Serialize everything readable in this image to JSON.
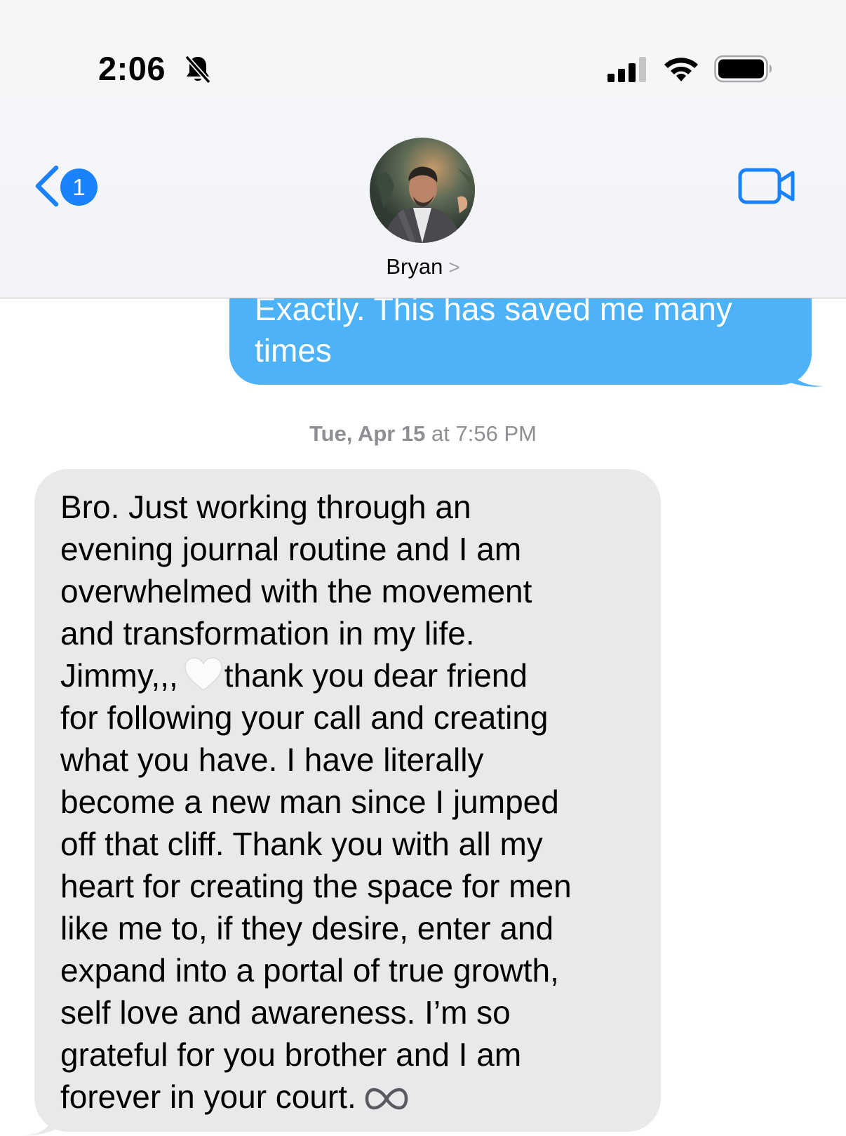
{
  "status_bar": {
    "time": "2:06",
    "icons": [
      "bell-slash-icon",
      "cellular-signal-icon",
      "wifi-icon",
      "battery-icon"
    ]
  },
  "header": {
    "back_badge_count": "1",
    "contact_name": "Bryan",
    "contact_chevron": ">",
    "video_icon": "video-camera-icon"
  },
  "messages": {
    "outgoing": {
      "lines": [
        "Exactly. This has saved me many",
        "times"
      ]
    },
    "timestamp": {
      "day": "Tue, Apr 15",
      "rest": " at 7:56 PM"
    },
    "incoming": {
      "line_1": "Bro. Just working through an",
      "line_2": "evening journal routine and I am",
      "line_3": "overwhelmed with the movement",
      "line_4": "and transformation in my life.",
      "line_5_a": "Jimmy,,,",
      "line_5_b": "thank you dear friend",
      "line_6": "for following your call and creating",
      "line_7": "what you have. I have literally",
      "line_8": "become a new man since I jumped",
      "line_9": "off that cliff. Thank you with all my",
      "line_10": "heart for creating the space for men",
      "line_11": "like me to, if they desire, enter and",
      "line_12": "expand into a portal of true growth,",
      "line_13": "self love and awareness. I’m so",
      "line_14": "grateful for you brother and I am",
      "line_15": "forever in your court.",
      "emojis": [
        "white-heart-icon",
        "infinity-icon"
      ]
    }
  },
  "colors": {
    "accent": "#1a82fb",
    "outgoing_bubble": "#4eb2f8",
    "incoming_bubble": "#e9e9eb",
    "timestamp": "#8e8e93"
  }
}
